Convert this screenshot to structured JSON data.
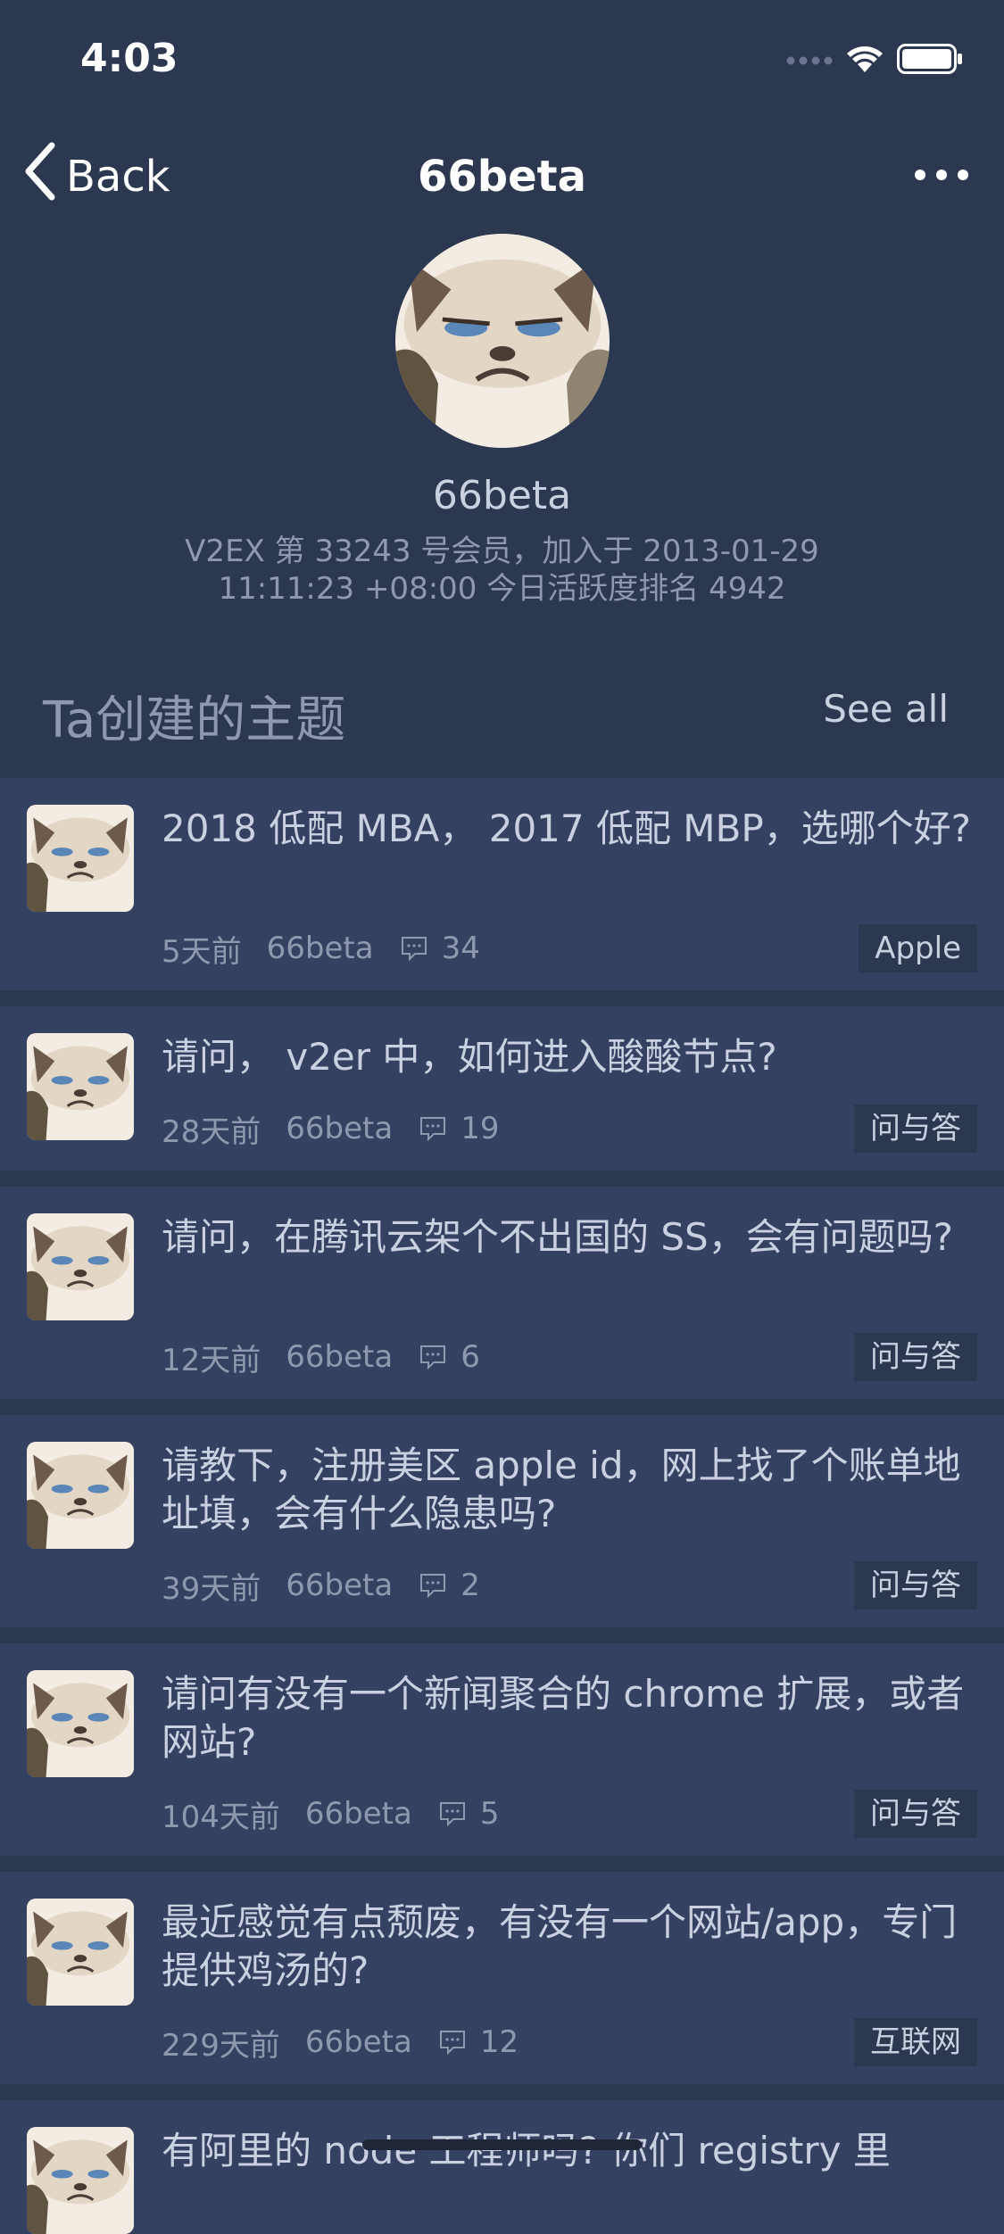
{
  "status_bar": {
    "time": "4:03"
  },
  "nav": {
    "back_label": "Back",
    "title": "66beta"
  },
  "profile": {
    "username": "66beta",
    "info_line1": "V2EX 第 33243 号会员，加入于 2013-01-29",
    "info_line2": "11:11:23 +08:00 今日活跃度排名 4942"
  },
  "section": {
    "title": "Ta创建的主题",
    "see_all": "See all"
  },
  "topics": [
    {
      "title": "2018 低配 MBA， 2017 低配 MBP，选哪个好?",
      "time": "5天前",
      "author": "66beta",
      "comments": "34",
      "node": "Apple"
    },
    {
      "title": "请问， v2er 中，如何进入酸酸节点?",
      "time": "28天前",
      "author": "66beta",
      "comments": "19",
      "node": "问与答"
    },
    {
      "title": "请问，在腾讯云架个不出国的 SS，会有问题吗?",
      "time": "12天前",
      "author": "66beta",
      "comments": "6",
      "node": "问与答"
    },
    {
      "title": "请教下，注册美区 apple id，网上找了个账单地址填，会有什么隐患吗?",
      "time": "39天前",
      "author": "66beta",
      "comments": "2",
      "node": "问与答"
    },
    {
      "title": "请问有没有一个新闻聚合的 chrome 扩展，或者网站?",
      "time": "104天前",
      "author": "66beta",
      "comments": "5",
      "node": "问与答"
    },
    {
      "title": "最近感觉有点颓废，有没有一个网站/app，专门提供鸡汤的?",
      "time": "229天前",
      "author": "66beta",
      "comments": "12",
      "node": "互联网"
    },
    {
      "title": "有阿里的 node 工程师吗? 你们 registry 里",
      "time": "",
      "author": "",
      "comments": "",
      "node": ""
    }
  ],
  "icons": {
    "back": "chevron-left-icon",
    "more": "ellipsis-icon",
    "comment": "comment-bubble-icon",
    "signal": "signal-dots-icon",
    "wifi": "wifi-icon",
    "battery": "battery-icon"
  },
  "colors": {
    "background": "#2c3750",
    "card": "#354160",
    "text": "#c9d0e0",
    "muted": "#8f99ae"
  }
}
